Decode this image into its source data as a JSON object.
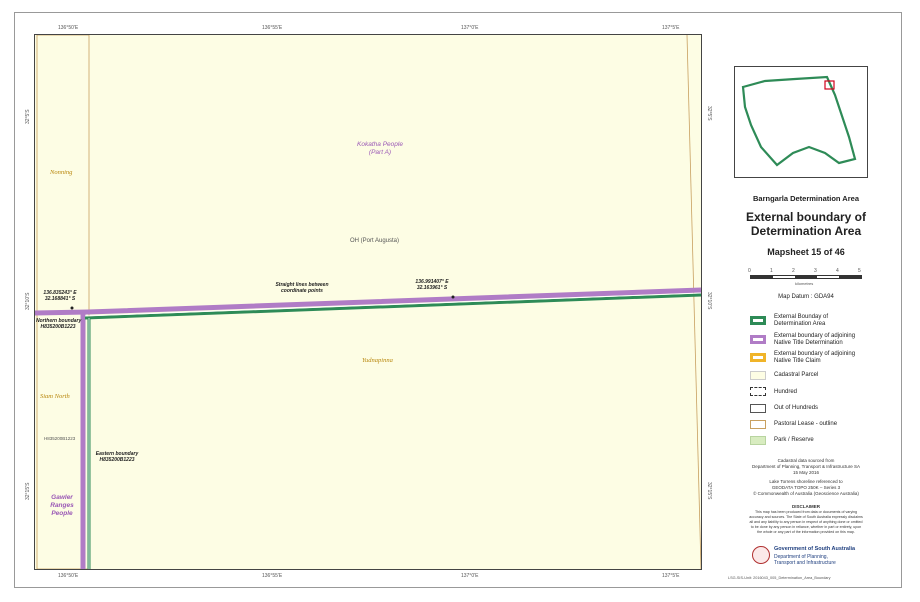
{
  "ticks": {
    "top": [
      "136°50'E",
      "136°55'E",
      "137°0'E",
      "137°5'E"
    ],
    "bottom": [
      "136°50'E",
      "136°55'E",
      "137°0'E",
      "137°5'E"
    ],
    "left": [
      "32°5'S",
      "32°10'S",
      "32°15'S"
    ],
    "right": [
      "32°5'S",
      "32°10'S",
      "32°15'S"
    ]
  },
  "map_labels": {
    "kokatha": "Kokatha People",
    "kokatha_sub": "(Part A)",
    "oh": "OH (Port Augusta)",
    "yudnapinna": "Yudnapinna",
    "nonning": "Nonning",
    "siam_north": "Siam North",
    "h_code": "H835200B1223",
    "gawler_1": "Gawler",
    "gawler_2": "Ranges",
    "gawler_3": "People",
    "coord_left_1": "136.835243° E",
    "coord_left_2": "32.168841° S",
    "coord_right_1": "136.991407° E",
    "coord_right_2": "32.163961° S",
    "straight_1": "Straight lines between",
    "straight_2": "coordinate points",
    "northern_1": "Northern boundary",
    "northern_2": "H835200B1223",
    "eastern_1": "Eastern boundary",
    "eastern_2": "H835200B1223"
  },
  "panel": {
    "area_title": "Barngarla Determination Area",
    "main_title_1": "External boundary of",
    "main_title_2": "Determination Area",
    "mapsheet": "Mapsheet 15 of 46",
    "scale_ticks": [
      "0",
      "1",
      "2",
      "3",
      "4",
      "5"
    ],
    "scale_unit": "kilometres",
    "datum": "Map Datum : GDA94"
  },
  "legend": [
    {
      "label_1": "External Bounday of",
      "label_2": "Determination Area",
      "color": "#2e8b57"
    },
    {
      "label_1": "External boundary of adjoining",
      "label_2": "Native Title Determination",
      "color": "#b07cc6"
    },
    {
      "label_1": "External boundary of adjoining",
      "label_2": "Native Title Claim",
      "color": "#f0b429"
    },
    {
      "label_1": "Cadastral Parcel",
      "label_2": "",
      "color": "#fdfde4"
    },
    {
      "label_1": "Hundred",
      "label_2": "",
      "color": "#333333"
    },
    {
      "label_1": "Out of Hundreds",
      "label_2": "",
      "color": "#555555"
    },
    {
      "label_1": "Pastoral Lease - outline",
      "label_2": "",
      "color": "#c8a060"
    },
    {
      "label_1": "Park / Reserve",
      "label_2": "",
      "color": "#d8ecc0"
    }
  ],
  "sources": {
    "line1": "Cadastral data sourced from",
    "line2": "Department of Planning, Transport & Infrastructure SA",
    "line3": "15 May 2016",
    "line4": "Lake Torrens shoreline referenced to",
    "line5": "GEODATA TOPO 250K – Series 3",
    "line6": "© Commonwealth of Australia (Geoscience Australia)"
  },
  "disclaimer": {
    "title": "DISCLAIMER",
    "line1": "This map has been produced from data or documents of varying",
    "line2": "accuracy and sources. The State of South Australia expressly disclaims",
    "line3": "all and any liability to any person in respect of anything done or omitted",
    "line4": "to be done by any person in reliance, whether in part or entirety, upon",
    "line5": "the whole or any part of the information provided on this map."
  },
  "gov": {
    "line1": "Government of South Australia",
    "line2": "Department of Planning,",
    "line3": "Transport and Infrastructure"
  },
  "footer": "LSG-SIS-Unit: 2016043_005_Determination_Area_Boundary"
}
